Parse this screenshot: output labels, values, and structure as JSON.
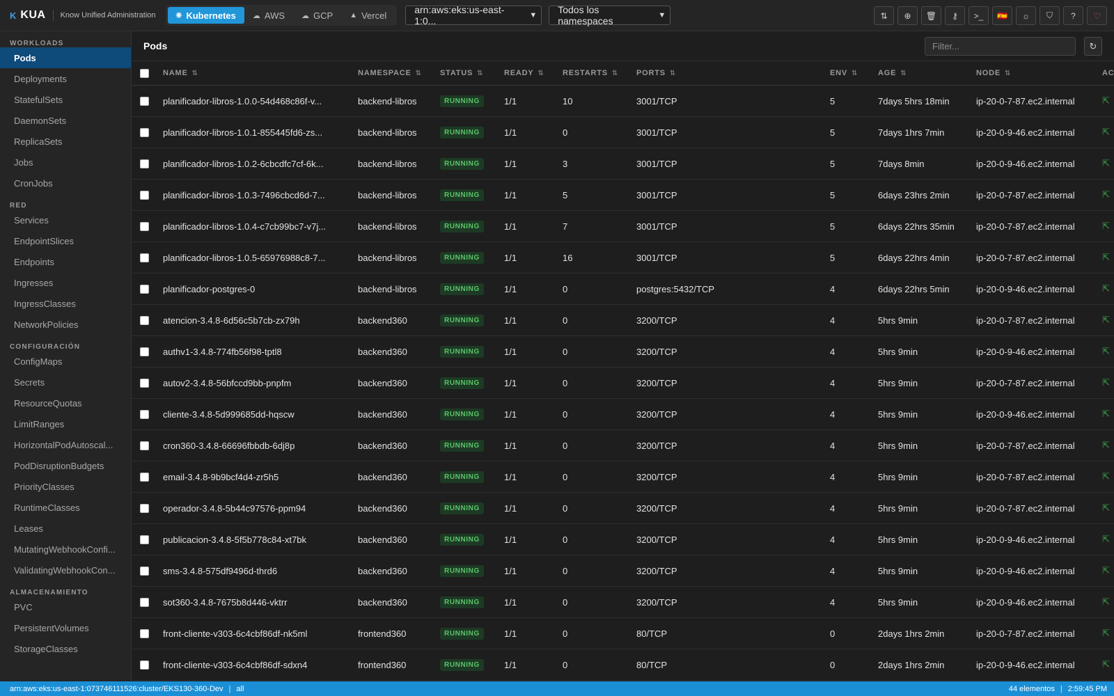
{
  "app": {
    "brand_mark": "K",
    "brand_name": "KUA",
    "brand_subtitle": "Know Unified Administration"
  },
  "providers": [
    {
      "label": "Kubernetes",
      "icon": "kubernetes-icon",
      "glyph": "⎈",
      "active": true
    },
    {
      "label": "AWS",
      "icon": "cloud-icon",
      "glyph": "☁",
      "active": false
    },
    {
      "label": "GCP",
      "icon": "cloud-icon",
      "glyph": "☁",
      "active": false
    },
    {
      "label": "Vercel",
      "icon": "triangle-icon",
      "glyph": "▲",
      "active": false
    }
  ],
  "selectors": {
    "cluster": "arn:aws:eks:us-east-1:0...",
    "namespace": "Todos los namespaces"
  },
  "toolbar_icons": [
    {
      "name": "swap-icon",
      "glyph": "⇅"
    },
    {
      "name": "add-circle-icon",
      "glyph": "⊕"
    },
    {
      "name": "trash-icon",
      "glyph": "🗑"
    },
    {
      "name": "key-icon",
      "glyph": "⚷"
    },
    {
      "name": "terminal-icon",
      "glyph": ">_"
    },
    {
      "name": "flag-es-icon",
      "glyph": "🇪🇸"
    },
    {
      "name": "sun-icon",
      "glyph": "☼"
    },
    {
      "name": "shield-icon",
      "glyph": "⛉"
    },
    {
      "name": "help-icon",
      "glyph": "?"
    },
    {
      "name": "heart-icon",
      "glyph": "♡"
    }
  ],
  "sidebar": {
    "sections": [
      {
        "title": "WORKLOADS",
        "items": [
          "Pods",
          "Deployments",
          "StatefulSets",
          "DaemonSets",
          "ReplicaSets",
          "Jobs",
          "CronJobs"
        ]
      },
      {
        "title": "RED",
        "items": [
          "Services",
          "EndpointSlices",
          "Endpoints",
          "Ingresses",
          "IngressClasses",
          "NetworkPolicies"
        ]
      },
      {
        "title": "CONFIGURACIÓN",
        "items": [
          "ConfigMaps",
          "Secrets",
          "ResourceQuotas",
          "LimitRanges",
          "HorizontalPodAutoscal...",
          "PodDisruptionBudgets",
          "PriorityClasses",
          "RuntimeClasses",
          "Leases",
          "MutatingWebhookConfi...",
          "ValidatingWebhookCon..."
        ]
      },
      {
        "title": "ALMACENAMIENTO",
        "items": [
          "PVC",
          "PersistentVolumes",
          "StorageClasses"
        ]
      }
    ],
    "active_item": "Pods"
  },
  "main": {
    "title": "Pods",
    "filter_placeholder": "Filter...",
    "columns": [
      "NAME",
      "NAMESPACE",
      "STATUS",
      "READY",
      "RESTARTS",
      "PORTS",
      "ENV",
      "AGE",
      "NODE",
      "AC"
    ],
    "rows": [
      [
        "planificador-libros-1.0.0-54d468c86f-v...",
        "backend-libros",
        "RUNNING",
        "1/1",
        "10",
        "3001/TCP",
        "5",
        "7days 5hrs 18min",
        "ip-20-0-7-87.ec2.internal"
      ],
      [
        "planificador-libros-1.0.1-855445fd6-zs...",
        "backend-libros",
        "RUNNING",
        "1/1",
        "0",
        "3001/TCP",
        "5",
        "7days 1hrs 7min",
        "ip-20-0-9-46.ec2.internal"
      ],
      [
        "planificador-libros-1.0.2-6cbcdfc7cf-6k...",
        "backend-libros",
        "RUNNING",
        "1/1",
        "3",
        "3001/TCP",
        "5",
        "7days 8min",
        "ip-20-0-9-46.ec2.internal"
      ],
      [
        "planificador-libros-1.0.3-7496cbcd6d-7...",
        "backend-libros",
        "RUNNING",
        "1/1",
        "5",
        "3001/TCP",
        "5",
        "6days 23hrs 2min",
        "ip-20-0-7-87.ec2.internal"
      ],
      [
        "planificador-libros-1.0.4-c7cb99bc7-v7j...",
        "backend-libros",
        "RUNNING",
        "1/1",
        "7",
        "3001/TCP",
        "5",
        "6days 22hrs 35min",
        "ip-20-0-7-87.ec2.internal"
      ],
      [
        "planificador-libros-1.0.5-65976988c8-7...",
        "backend-libros",
        "RUNNING",
        "1/1",
        "16",
        "3001/TCP",
        "5",
        "6days 22hrs 4min",
        "ip-20-0-7-87.ec2.internal"
      ],
      [
        "planificador-postgres-0",
        "backend-libros",
        "RUNNING",
        "1/1",
        "0",
        "postgres:5432/TCP",
        "4",
        "6days 22hrs 5min",
        "ip-20-0-9-46.ec2.internal"
      ],
      [
        "atencion-3.4.8-6d56c5b7cb-zx79h",
        "backend360",
        "RUNNING",
        "1/1",
        "0",
        "3200/TCP",
        "4",
        "5hrs 9min",
        "ip-20-0-7-87.ec2.internal"
      ],
      [
        "authv1-3.4.8-774fb56f98-tptl8",
        "backend360",
        "RUNNING",
        "1/1",
        "0",
        "3200/TCP",
        "4",
        "5hrs 9min",
        "ip-20-0-9-46.ec2.internal"
      ],
      [
        "autov2-3.4.8-56bfccd9bb-pnpfm",
        "backend360",
        "RUNNING",
        "1/1",
        "0",
        "3200/TCP",
        "4",
        "5hrs 9min",
        "ip-20-0-7-87.ec2.internal"
      ],
      [
        "cliente-3.4.8-5d999685dd-hqscw",
        "backend360",
        "RUNNING",
        "1/1",
        "0",
        "3200/TCP",
        "4",
        "5hrs 9min",
        "ip-20-0-9-46.ec2.internal"
      ],
      [
        "cron360-3.4.8-66696fbbdb-6dj8p",
        "backend360",
        "RUNNING",
        "1/1",
        "0",
        "3200/TCP",
        "4",
        "5hrs 9min",
        "ip-20-0-7-87.ec2.internal"
      ],
      [
        "email-3.4.8-9b9bcf4d4-zr5h5",
        "backend360",
        "RUNNING",
        "1/1",
        "0",
        "3200/TCP",
        "4",
        "5hrs 9min",
        "ip-20-0-7-87.ec2.internal"
      ],
      [
        "operador-3.4.8-5b44c97576-ppm94",
        "backend360",
        "RUNNING",
        "1/1",
        "0",
        "3200/TCP",
        "4",
        "5hrs 9min",
        "ip-20-0-7-87.ec2.internal"
      ],
      [
        "publicacion-3.4.8-5f5b778c84-xt7bk",
        "backend360",
        "RUNNING",
        "1/1",
        "0",
        "3200/TCP",
        "4",
        "5hrs 9min",
        "ip-20-0-9-46.ec2.internal"
      ],
      [
        "sms-3.4.8-575df9496d-thrd6",
        "backend360",
        "RUNNING",
        "1/1",
        "0",
        "3200/TCP",
        "4",
        "5hrs 9min",
        "ip-20-0-9-46.ec2.internal"
      ],
      [
        "sot360-3.4.8-7675b8d446-vktrr",
        "backend360",
        "RUNNING",
        "1/1",
        "0",
        "3200/TCP",
        "4",
        "5hrs 9min",
        "ip-20-0-9-46.ec2.internal"
      ],
      [
        "front-cliente-v303-6c4cbf86df-nk5ml",
        "frontend360",
        "RUNNING",
        "1/1",
        "0",
        "80/TCP",
        "0",
        "2days 1hrs 2min",
        "ip-20-0-7-87.ec2.internal"
      ],
      [
        "front-cliente-v303-6c4cbf86df-sdxn4",
        "frontend360",
        "RUNNING",
        "1/1",
        "0",
        "80/TCP",
        "0",
        "2days 1hrs 2min",
        "ip-20-0-9-46.ec2.internal"
      ]
    ]
  },
  "statusbar": {
    "cluster": "arn:aws:eks:us-east-1:073746111526:cluster/EKS130-360-Dev",
    "separator": "|",
    "namespace": "all",
    "count": "44 elementos",
    "time": "2:59:45 PM"
  },
  "colors": {
    "accent": "#2196d9",
    "statusbar": "#1a8fd6",
    "running_text": "#5cc46a",
    "running_bg": "#1d3a24",
    "sidebar_active": "#0e4a7a"
  }
}
